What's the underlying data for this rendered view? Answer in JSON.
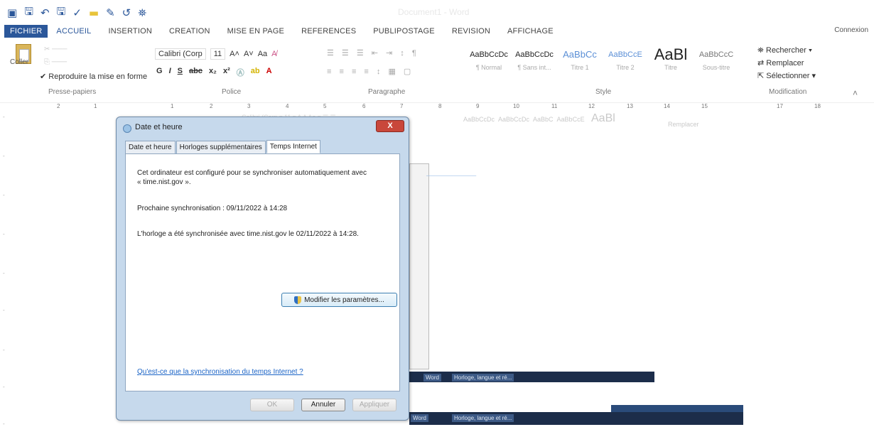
{
  "window": {
    "title": "Document1 - Word"
  },
  "ribbon_tabs": [
    "FICHIER",
    "ACCUEIL",
    "INSERTION",
    "CREATION",
    "MISE EN PAGE",
    "REFERENCES",
    "PUBLIPOSTAGE",
    "REVISION",
    "AFFICHAGE"
  ],
  "account": "Connexion",
  "clipboard": {
    "paste_label": "Coller",
    "format_painter": "Reproduire la mise en forme",
    "group": "Presse-papiers"
  },
  "font": {
    "name": "Calibri (Corp",
    "size": "11",
    "group": "Police"
  },
  "paragraph": {
    "group": "Paragraphe"
  },
  "styles": {
    "group": "Style",
    "items": [
      {
        "sample": "AaBbCcDc",
        "name": "¶ Normal"
      },
      {
        "sample": "AaBbCcDc",
        "name": "¶ Sans int..."
      },
      {
        "sample": "AaBbCc",
        "name": "Titre 1"
      },
      {
        "sample": "AaBbCcE",
        "name": "Titre 2"
      },
      {
        "sample": "AaBl",
        "name": "Titre"
      },
      {
        "sample": "AaBbCcC",
        "name": "Sous-titre"
      }
    ]
  },
  "editing": {
    "find": "Rechercher",
    "replace": "Remplacer",
    "select": "Sélectionner",
    "group": "Modification"
  },
  "ruler_ticks": [
    "2",
    "1",
    "1",
    "2",
    "3",
    "4",
    "5",
    "6",
    "7",
    "8",
    "9",
    "10",
    "11",
    "12",
    "13",
    "14",
    "15",
    "17",
    "18"
  ],
  "dialog": {
    "title": "Date et heure",
    "close_label": "X",
    "tabs": [
      "Date et heure",
      "Horloges supplémentaires",
      "Temps Internet"
    ],
    "active_tab": "Temps Internet",
    "sync_text_line1": "Cet ordinateur est configuré pour se synchroniser automatiquement avec",
    "sync_text_line2": "« time.nist.gov ».",
    "next_sync": "Prochaine synchronisation : 09/11/2022 à 14:28",
    "last_sync": "L'horloge a été synchronisée avec time.nist.gov le 02/11/2022 à 14:28.",
    "modify_button": "Modifier les paramètres...",
    "help_link": "Qu'est-ce que la synchronisation du temps Internet ?",
    "ok": "OK",
    "cancel": "Annuler",
    "apply": "Appliquer"
  },
  "taskbar": {
    "items": [
      "Word",
      "Horloge, langue et ré...",
      "Word"
    ]
  }
}
